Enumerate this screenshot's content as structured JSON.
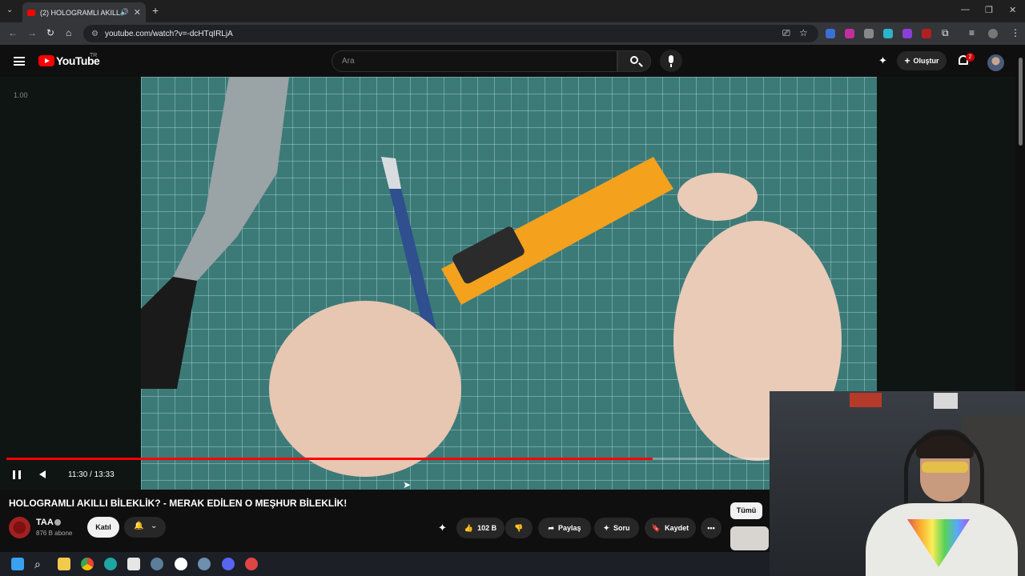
{
  "browser": {
    "tab_title": "(2) HOLOGRAMLI AKILLI Bİ...",
    "url": "youtube.com/watch?v=-dcHTqIRLjA"
  },
  "youtube": {
    "logo_text": "YouTube",
    "region": "TR",
    "search_placeholder": "Ara",
    "create_label": "Oluştur",
    "notification_count": "2"
  },
  "player": {
    "speed": "1.00",
    "time": "11:30 / 13:33",
    "progress": 0.848
  },
  "video": {
    "title": "HOLOGRAMLI AKILLI BİLEKLİK? - MERAK EDİLEN O MEŞHUR BİLEKLİK!",
    "channel_name": "TAA",
    "subscribers": "876 B abone",
    "join_label": "Katıl",
    "likes": "102 B",
    "share_label": "Paylaş",
    "ask_label": "Soru",
    "save_label": "Kaydet"
  },
  "sidebar": {
    "chip_all": "Tümü"
  },
  "colors": {
    "accent": "#ff0000",
    "background": "#0f0f0f"
  }
}
